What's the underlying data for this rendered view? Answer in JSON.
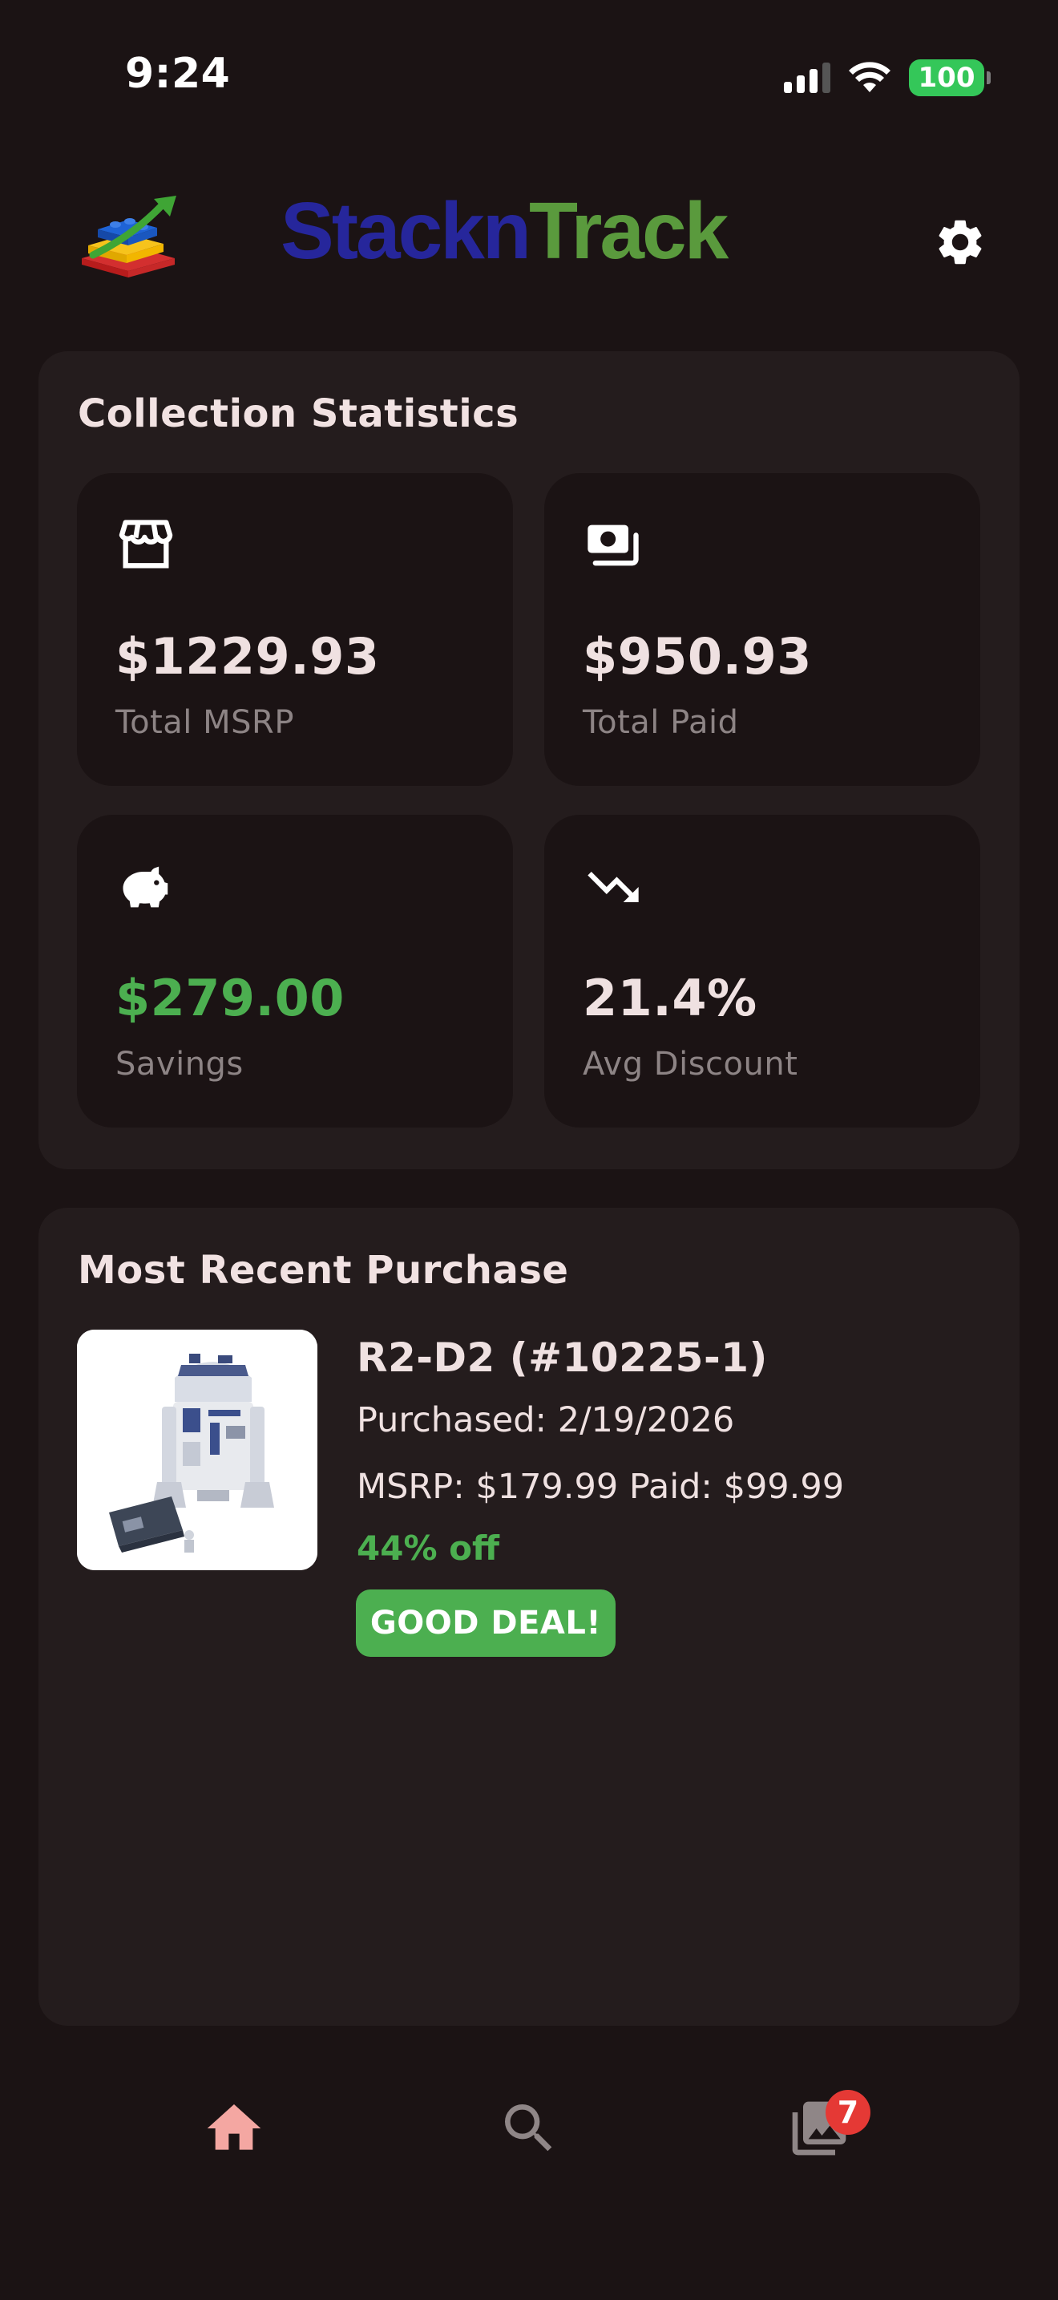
{
  "status_bar": {
    "time": "9:24",
    "battery": "100"
  },
  "header": {
    "brand_part1": "Stackn",
    "brand_part2": "Track",
    "logo_icon": "stacked-bricks-logo-icon",
    "settings_icon": "gear-icon"
  },
  "stats": {
    "title": "Collection Statistics",
    "items": [
      {
        "icon": "store-icon",
        "value": "$1229.93",
        "label": "Total MSRP"
      },
      {
        "icon": "money-icon",
        "value": "$950.93",
        "label": "Total Paid"
      },
      {
        "icon": "piggy-bank-icon",
        "value": "$279.00",
        "label": "Savings"
      },
      {
        "icon": "trending-down-icon",
        "value": "21.4%",
        "label": "Avg Discount"
      }
    ]
  },
  "recent": {
    "title": "Most Recent Purchase",
    "name": "R2-D2 (#10225-1)",
    "purchased": "Purchased: 2/19/2026",
    "prices": "MSRP: $179.99  Paid: $99.99",
    "discount": "44% off",
    "badge": "GOOD DEAL!"
  },
  "bottom_nav": {
    "items": [
      {
        "icon": "home-icon",
        "active": true
      },
      {
        "icon": "search-icon",
        "active": false
      },
      {
        "icon": "gallery-icon",
        "active": false
      }
    ],
    "gallery_badge": "7"
  },
  "colors": {
    "background": "#1b1314",
    "card": "#241c1d",
    "accent_green": "#4caf50",
    "brand_blue": "#26269b",
    "brand_green": "#5a9a3d",
    "nav_active": "#f4a7a2",
    "badge_red": "#e53935"
  }
}
